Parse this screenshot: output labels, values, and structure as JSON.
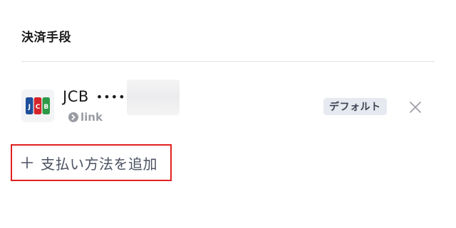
{
  "section": {
    "title": "決済手段"
  },
  "payment_method": {
    "brand": "JCB",
    "masked_number": "••••",
    "source_icon": "chevron-circle-icon",
    "source_label": "link",
    "default_badge": "デフォルト",
    "remove_icon": "close-icon",
    "logo_icon": "jcb-logo-icon"
  },
  "add_method": {
    "icon": "plus-icon",
    "label": "支払い方法を追加"
  },
  "colors": {
    "highlight_border": "#e02020",
    "badge_background": "#e6eaf0",
    "muted_text": "#9a9ca3",
    "jcb_blue": "#1d4f9c",
    "jcb_red": "#d4252b",
    "jcb_green": "#2e9a48"
  }
}
